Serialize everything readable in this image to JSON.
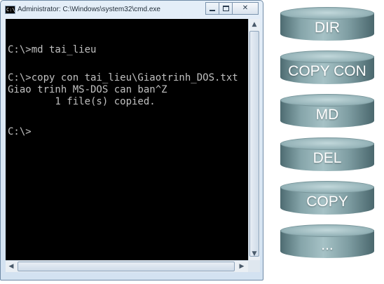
{
  "window": {
    "title": "Administrator: C:\\Windows\\system32\\cmd.exe",
    "icon_text": "C:\\",
    "buttons": {
      "minimize": "minimize-icon",
      "maximize": "maximize-icon",
      "close": "close-icon"
    },
    "colors": {
      "console_bg": "#000000",
      "console_fg": "#c0c0c0",
      "frame": "#d3e2f1"
    }
  },
  "console": {
    "lines": [
      "C:\\>md tai_lieu",
      "C:\\>copy con tai_lieu\\Giaotrinh_DOS.txt",
      "Giao trinh MS-DOS can ban^Z",
      "        1 file(s) copied.",
      "C:\\>"
    ]
  },
  "scrollbars": {
    "up": "▲",
    "down": "▼",
    "left": "◀",
    "right": "▶"
  },
  "commands": [
    "DIR",
    "COPY CON",
    "MD",
    "DEL",
    "COPY",
    "..."
  ],
  "cylinder_colors": {
    "light": "#a6c2c6",
    "mid": "#86a5aa",
    "dark": "#4d6b71",
    "text": "#ffffff"
  }
}
